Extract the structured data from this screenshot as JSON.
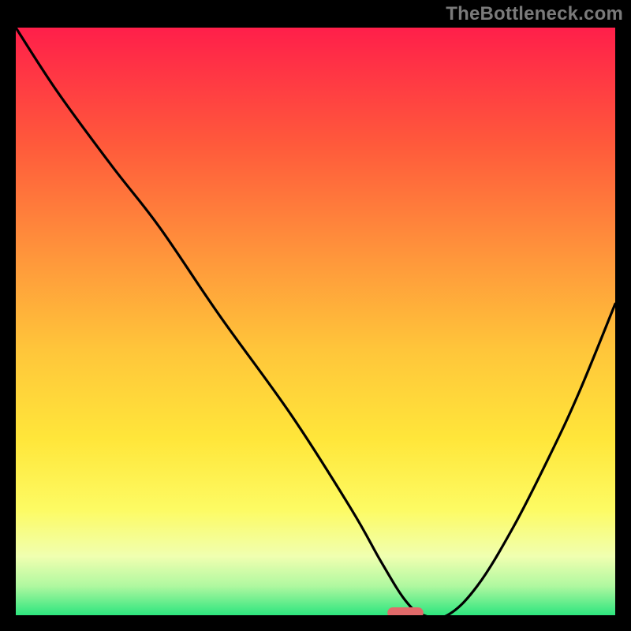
{
  "watermark": "TheBottleneck.com",
  "chart_data": {
    "type": "line",
    "title": "",
    "xlabel": "",
    "ylabel": "",
    "xlim": [
      0,
      100
    ],
    "ylim": [
      0,
      100
    ],
    "grid": false,
    "legend": false,
    "background_gradient": {
      "stops": [
        {
          "offset": 0.0,
          "color": "#ff1f4a"
        },
        {
          "offset": 0.2,
          "color": "#ff5a3b"
        },
        {
          "offset": 0.4,
          "color": "#ff993b"
        },
        {
          "offset": 0.55,
          "color": "#ffc63a"
        },
        {
          "offset": 0.7,
          "color": "#ffe63a"
        },
        {
          "offset": 0.82,
          "color": "#fdfb63"
        },
        {
          "offset": 0.9,
          "color": "#f0ffb0"
        },
        {
          "offset": 0.95,
          "color": "#b0f8a0"
        },
        {
          "offset": 1.0,
          "color": "#2de57e"
        }
      ]
    },
    "series": [
      {
        "name": "bottleneck-curve",
        "color": "#000000",
        "x": [
          0.0,
          7.0,
          16.0,
          24.0,
          34.0,
          46.0,
          56.0,
          61.0,
          65.0,
          68.0,
          72.0,
          77.0,
          83.0,
          89.0,
          94.0,
          100.0
        ],
        "y": [
          100.0,
          89.0,
          76.5,
          66.0,
          51.0,
          34.0,
          18.0,
          9.0,
          2.5,
          0.0,
          0.0,
          5.0,
          15.0,
          27.0,
          38.0,
          53.0
        ]
      }
    ],
    "marker": {
      "name": "optimal-pill",
      "color": "#e16a6a",
      "x_center": 65.0,
      "y": 0.0,
      "width": 6.0
    }
  }
}
